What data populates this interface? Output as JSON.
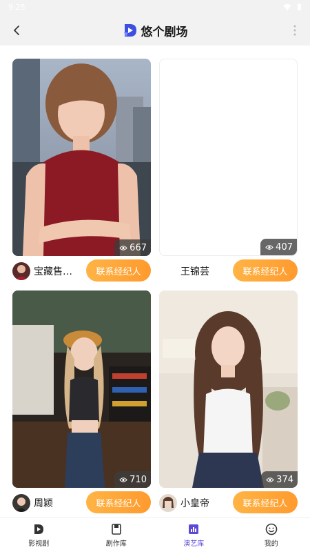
{
  "status": {
    "time": "9:25"
  },
  "header": {
    "title": "悠个剧场"
  },
  "cards": [
    {
      "views": "667",
      "name": "宝藏售…",
      "button": "联系经纪人"
    },
    {
      "views": "407",
      "name": "王锦芸",
      "button": "联系经纪人"
    },
    {
      "views": "710",
      "name": "周颖",
      "button": "联系经纪人"
    },
    {
      "views": "374",
      "name": "小皇帝",
      "button": "联系经纪人"
    }
  ],
  "nav": [
    {
      "label": "影视剧",
      "icon": "film-icon"
    },
    {
      "label": "剧作库",
      "icon": "script-icon"
    },
    {
      "label": "演艺库",
      "icon": "chart-icon",
      "active": true
    },
    {
      "label": "我的",
      "icon": "smile-icon"
    }
  ],
  "colors": {
    "accent": "#ff9a2e",
    "nav_active": "#5a4ad6",
    "header_bg": "#f2f2f2"
  }
}
